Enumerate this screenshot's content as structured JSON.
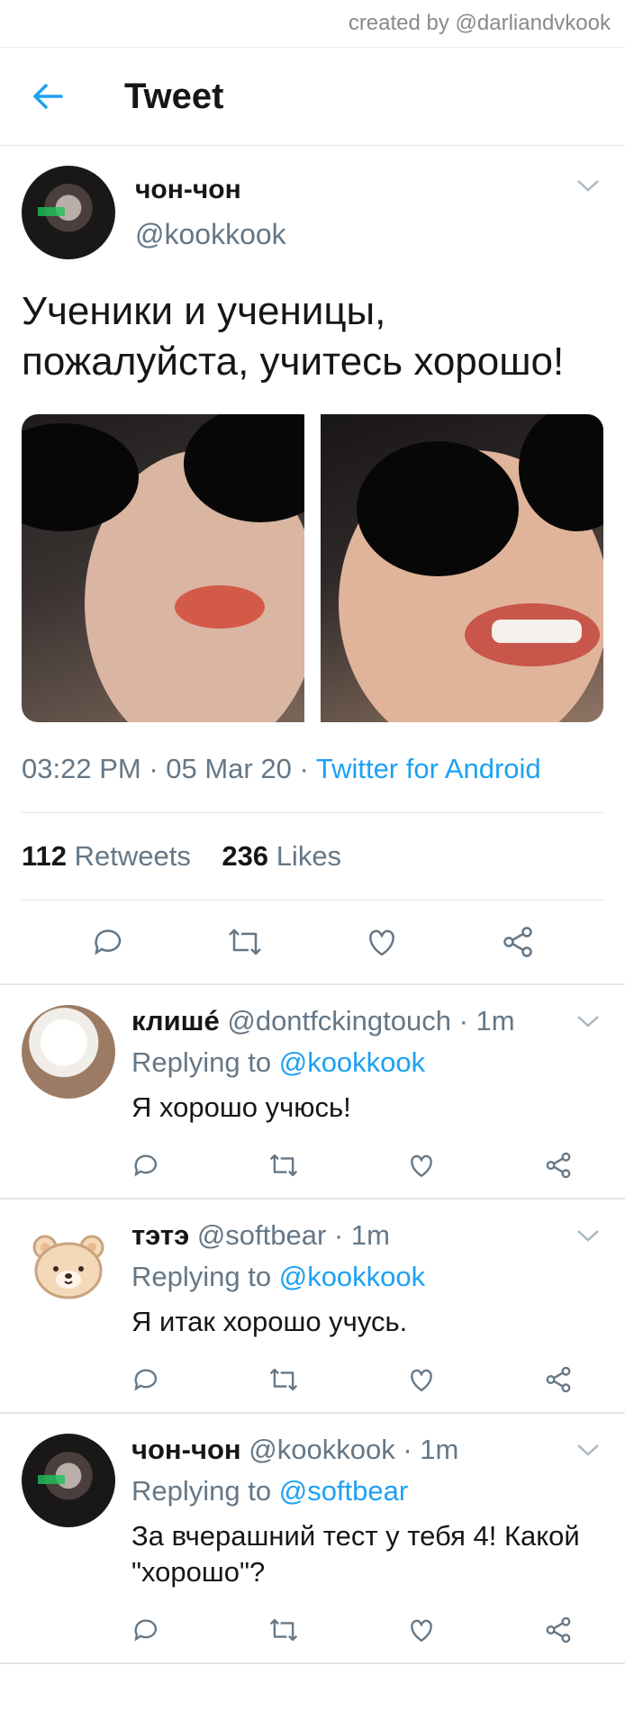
{
  "watermark": "created by @darliandvkook",
  "header": {
    "title": "Tweet",
    "back_icon": "arrow-left-icon",
    "accent": "#1da1f2"
  },
  "tweet": {
    "name": "чон-чон",
    "handle": "@kookkook",
    "text": "Ученики и ученицы, пожалуйста, учитесь хорошо!",
    "time": "03:22 PM",
    "date": "05 Mar 20",
    "source": "Twitter for Android",
    "retweets": "112",
    "retweets_label": "Retweets",
    "likes": "236",
    "likes_label": "Likes"
  },
  "replies": [
    {
      "name": "клишé",
      "handle": "@dontfckingtouch",
      "time": "1m",
      "replying_label": "Replying to",
      "mention": "@kookkook",
      "text": "Я хорошо учюсь!"
    },
    {
      "name": "тэтэ",
      "handle": "@softbear",
      "time": "1m",
      "replying_label": "Replying to",
      "mention": "@kookkook",
      "text": "Я итак хорошо учусь."
    },
    {
      "name": "чон-чон",
      "handle": "@kookkook",
      "time": "1m",
      "replying_label": "Replying to",
      "mention": "@softbear",
      "text": "За вчерашний тест у тебя 4! Какой \"хорошо\"?"
    }
  ],
  "separator": " · "
}
